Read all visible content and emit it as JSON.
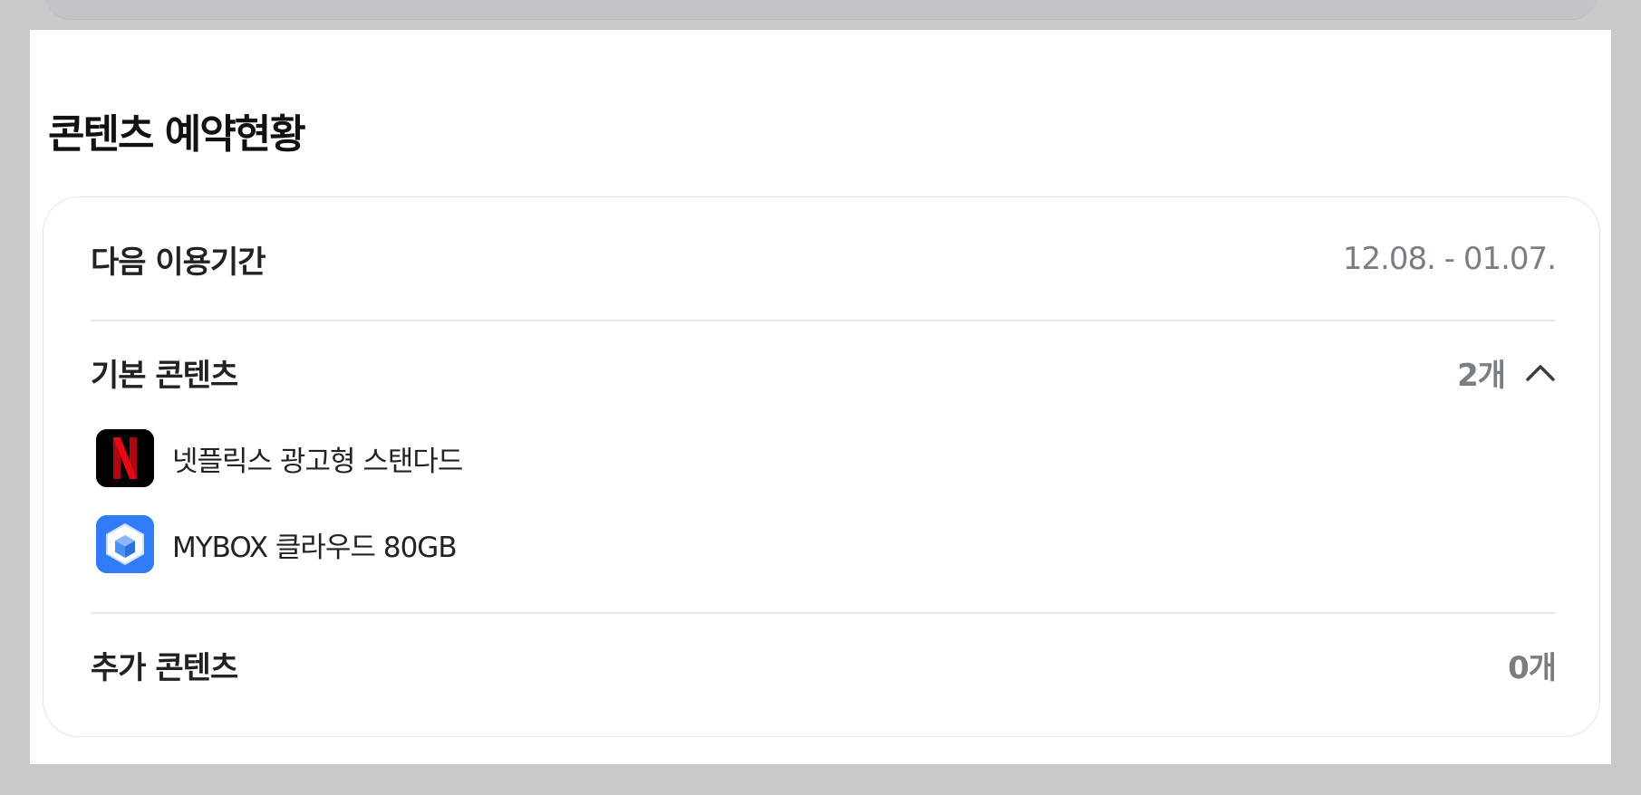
{
  "section": {
    "title": "콘텐츠 예약현황"
  },
  "next_period": {
    "label": "다음 이용기간",
    "value": "12.08. - 01.07."
  },
  "basic_contents": {
    "label": "기본 콘텐츠",
    "count": "2개",
    "expanded": true,
    "items": [
      {
        "label": "넷플릭스 광고형 스탠다드",
        "icon": "netflix-icon",
        "brand_color": "#e50914"
      },
      {
        "label": "MYBOX 클라우드 80GB",
        "icon": "mybox-icon",
        "brand_color": "#2f7cf6"
      }
    ]
  },
  "extra_contents": {
    "label": "추가 콘텐츠",
    "count": "0개"
  },
  "colors": {
    "background": "#c9c9cb",
    "panel": "#ffffff",
    "muted_text": "#7a7d82",
    "divider": "#e6e7e9"
  }
}
